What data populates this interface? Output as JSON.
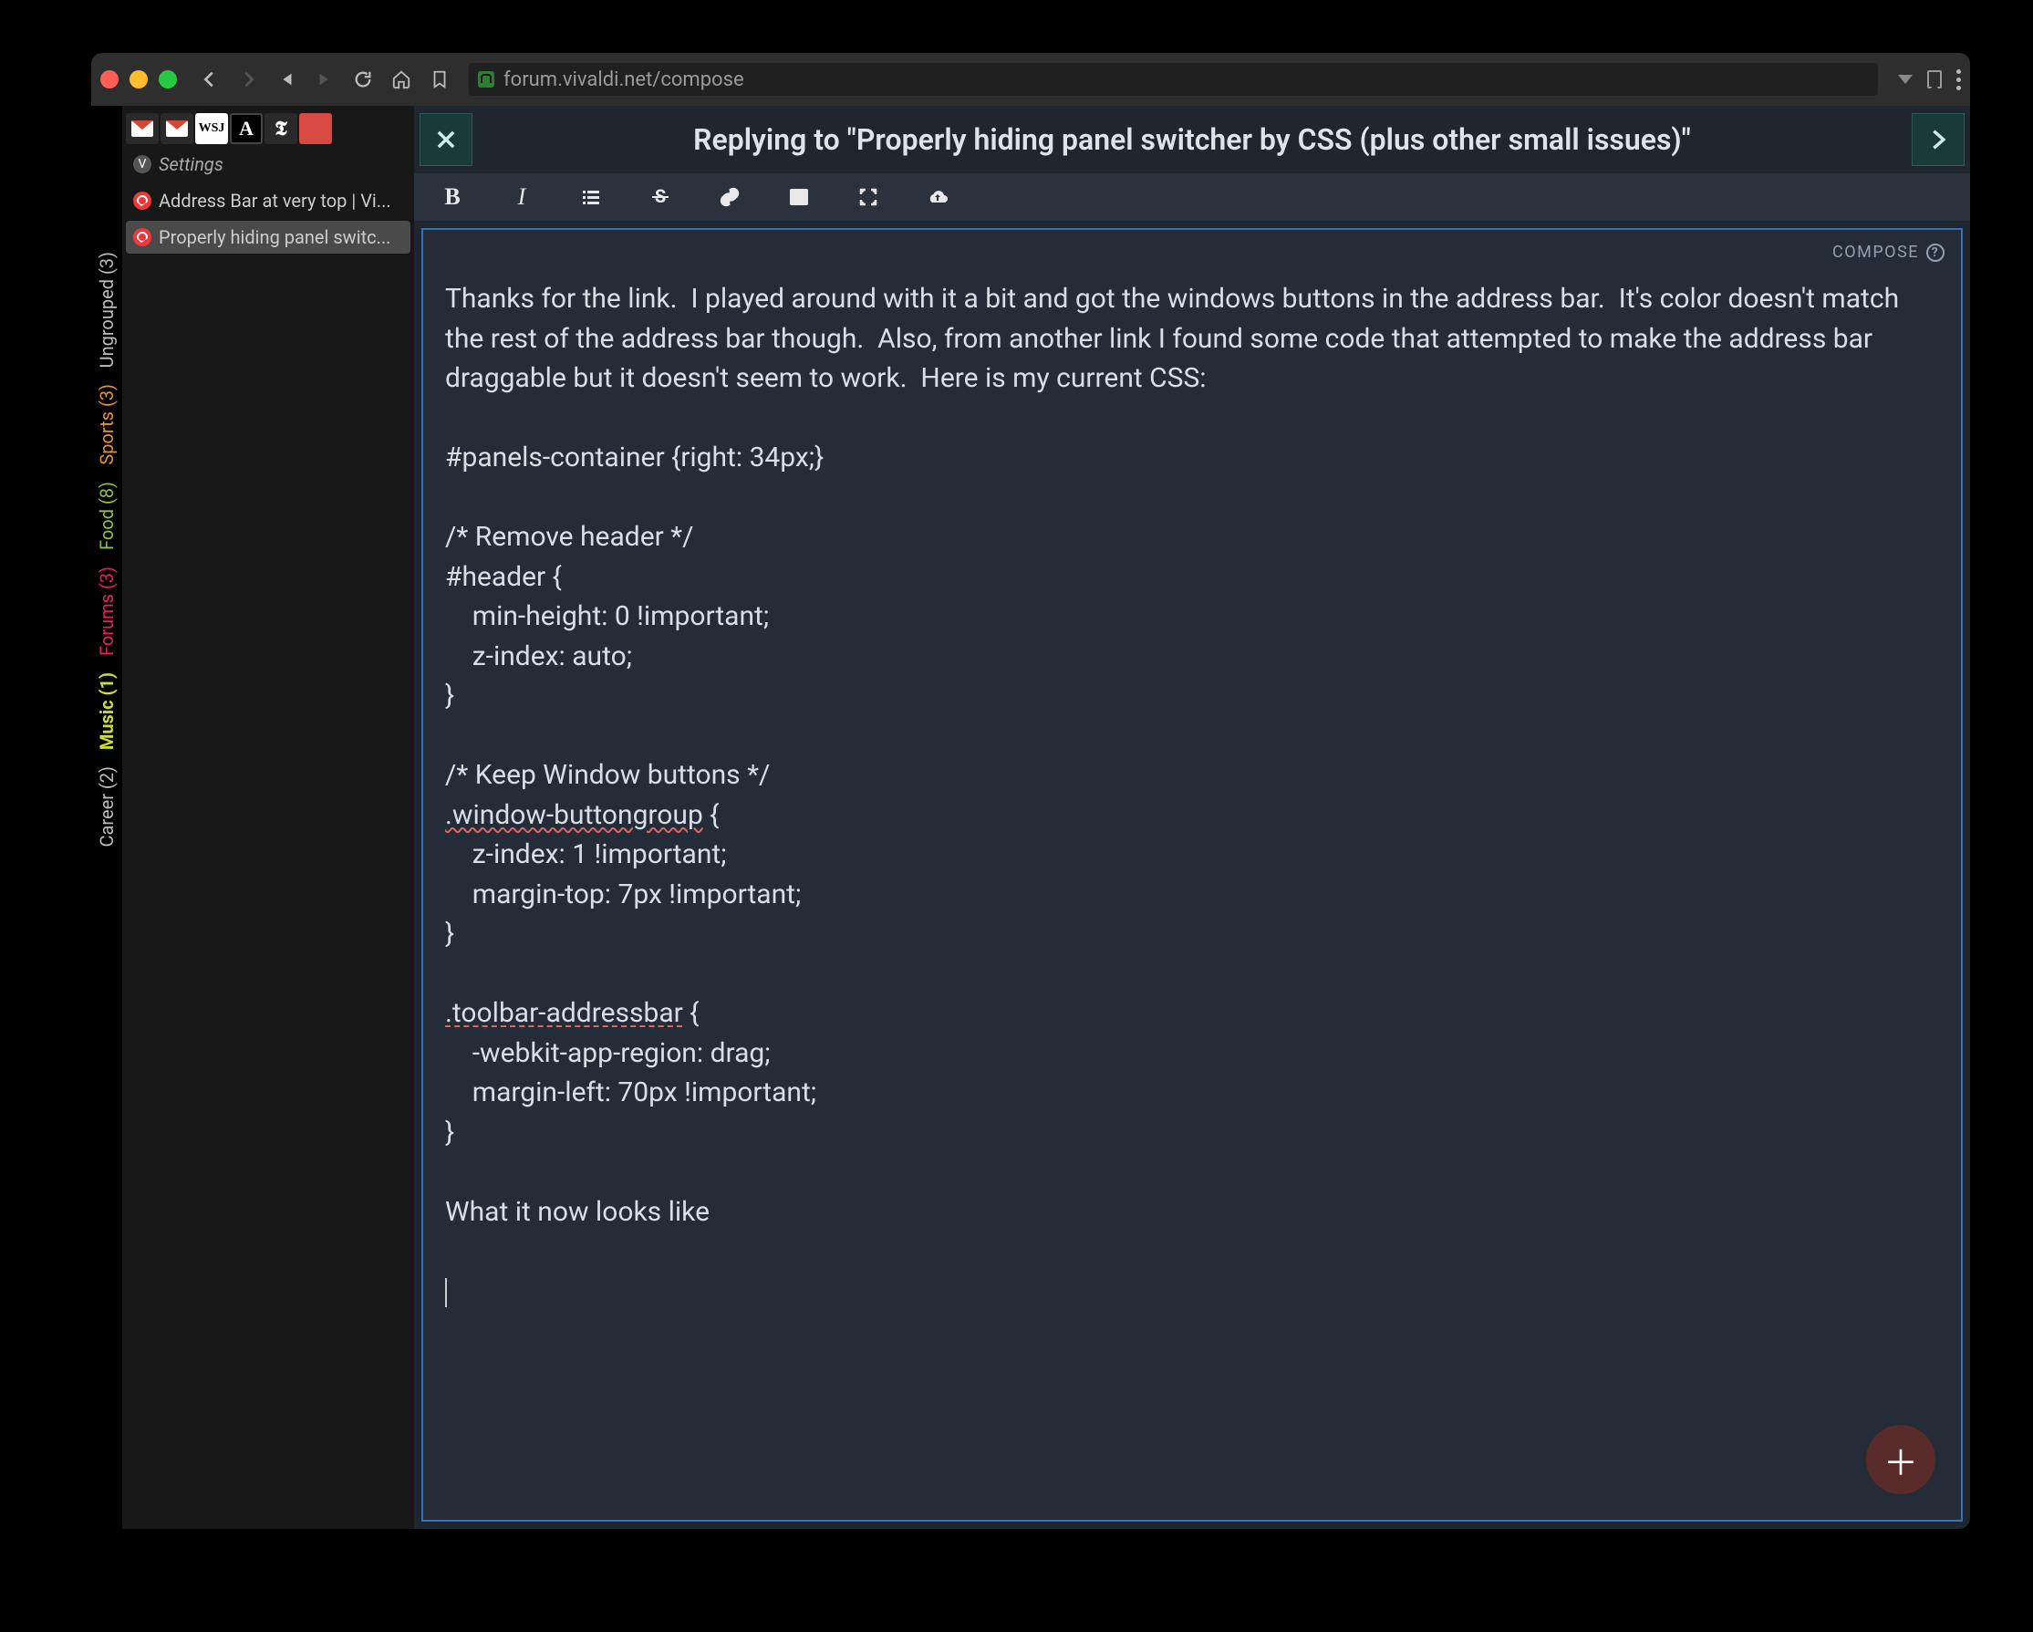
{
  "addressbar": {
    "url": "forum.vivaldi.net/compose"
  },
  "gutter": {
    "ungrouped": "Ungrouped (3)",
    "sports": "Sports (3)",
    "food": "Food (8)",
    "forums": "Forums (3)",
    "music": "Music (1)",
    "career": "Career (2)"
  },
  "tabs": {
    "settings": "Settings",
    "addr": "Address Bar at very top | Vi...",
    "hide": "Properly hiding panel switc..."
  },
  "composer": {
    "title": "Replying to \"Properly hiding panel switcher by CSS (plus other small issues)\"",
    "compose_label": "COMPOSE",
    "body_intro": "Thanks for the link.  I played around with it a bit and got the windows buttons in the address bar.  It's color doesn't match the rest of the address bar though.  Also, from another link I found some code that attempted to make the address bar draggable but it doesn't seem to work.  Here is my current CSS:",
    "css1": "#panels-container {right: 34px;}",
    "cmt1": "/* Remove header */",
    "hdr_open": "#header {",
    "hdr_l1": "    min-height: 0 !important;",
    "hdr_l2": "    z-index: auto;",
    "brace": "}",
    "cmt2": "/* Keep Window buttons */",
    "wb_sel": ".window-buttongroup",
    "wb_open": " {",
    "wb_l1": "    z-index: 1 !important;",
    "wb_l2": "    margin-top: 7px !important;",
    "ta_sel": ".toolbar-addressbar",
    "ta_open": " {",
    "ta_l1": "    -webkit-app-region: drag;",
    "ta_l2": "    margin-left: 70px !important;",
    "outro": "What it now looks like"
  }
}
